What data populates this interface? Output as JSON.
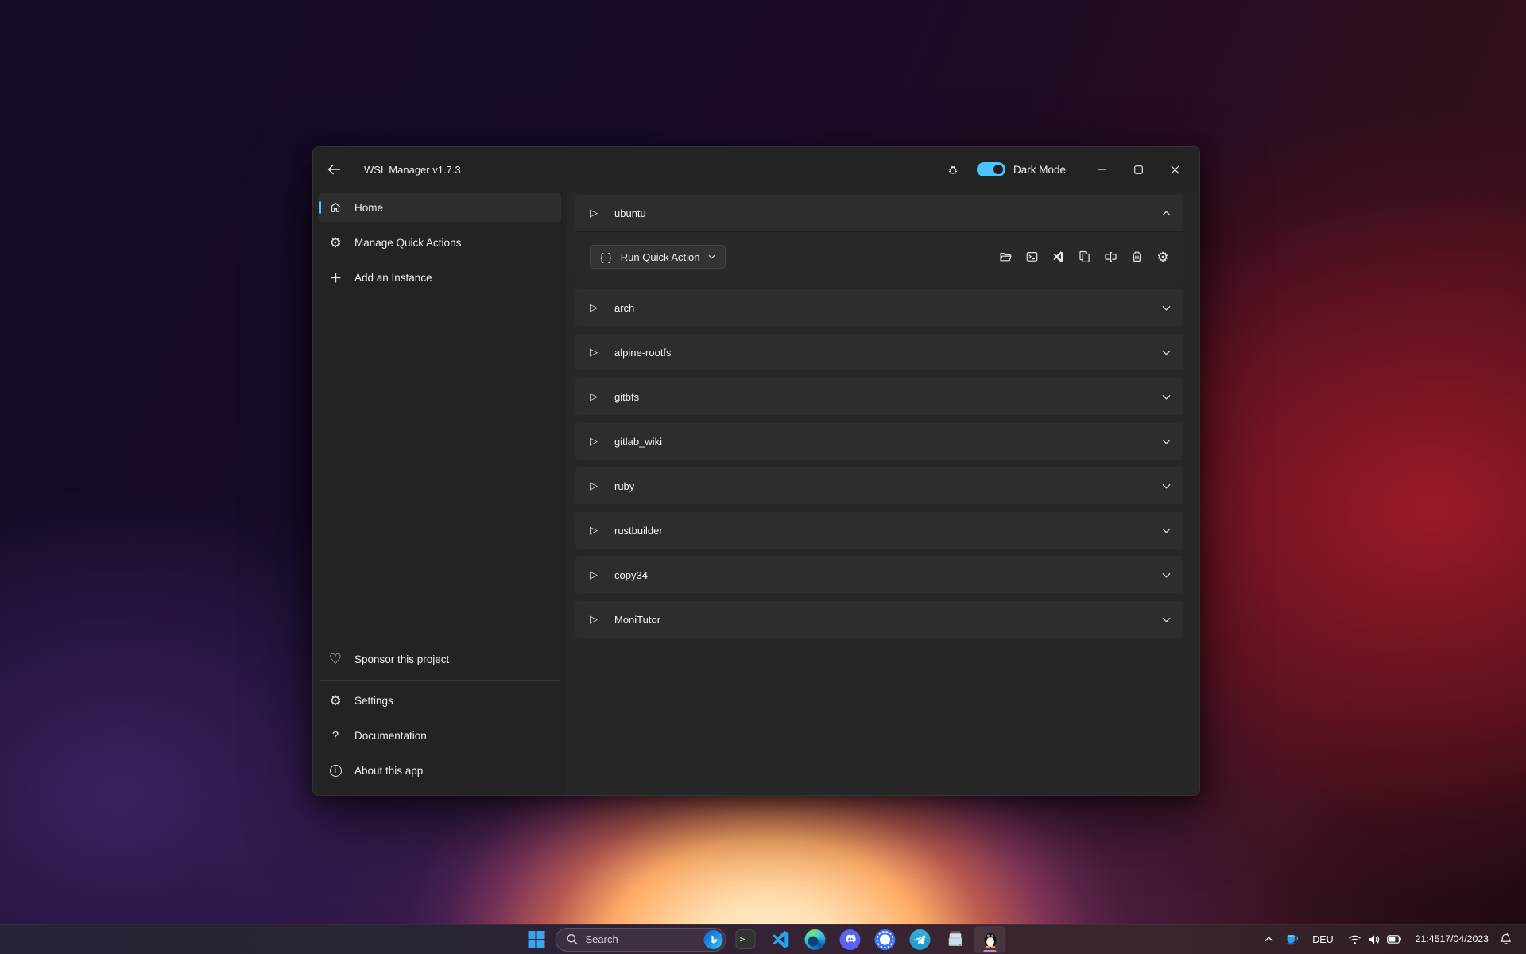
{
  "colors": {
    "accent": "#4cc2ff",
    "taskbar_active_indicator": "#c77fd9"
  },
  "icons": {
    "gear": "⚙",
    "play_outline": "▷",
    "braces": "{ }",
    "heart": "♡",
    "question": "?",
    "info_i": "i"
  },
  "window": {
    "title": "WSL Manager v1.7.3",
    "titlebar": {
      "dark_mode_label": "Dark Mode",
      "dark_mode_on": true
    },
    "sidebar": {
      "items": [
        {
          "label": "Home",
          "icon": "home-icon",
          "selected": true
        },
        {
          "label": "Manage Quick Actions",
          "icon": "gear-icon",
          "selected": false
        },
        {
          "label": "Add an Instance",
          "icon": "plus-icon",
          "selected": false
        }
      ],
      "bottom_items": [
        {
          "label": "Sponsor this project",
          "icon": "heart-icon"
        },
        {
          "label": "Settings",
          "icon": "gear-icon"
        },
        {
          "label": "Documentation",
          "icon": "question-icon"
        },
        {
          "label": "About this app",
          "icon": "info-icon"
        }
      ]
    },
    "main": {
      "expanded_instance": {
        "name": "ubuntu",
        "quick_action_label": "Run Quick Action",
        "action_icons": [
          "open-folder-icon",
          "terminal-icon",
          "vscode-icon",
          "copy-icon",
          "rename-icon",
          "delete-icon",
          "settings-icon"
        ]
      },
      "collapsed_instances": [
        "arch",
        "alpine-rootfs",
        "gitbfs",
        "gitlab_wiki",
        "ruby",
        "rustbuilder",
        "copy34",
        "MoniTutor"
      ]
    }
  },
  "taskbar": {
    "search_label": "Search",
    "language": "DEU",
    "clock": {
      "time": "21:45",
      "date": "17/04/2023"
    },
    "apps": [
      "start",
      "search",
      "terminal",
      "vscode",
      "edge",
      "discord",
      "signal",
      "telegram",
      "scanner",
      "wsl-manager"
    ],
    "active_app": "wsl-manager"
  }
}
